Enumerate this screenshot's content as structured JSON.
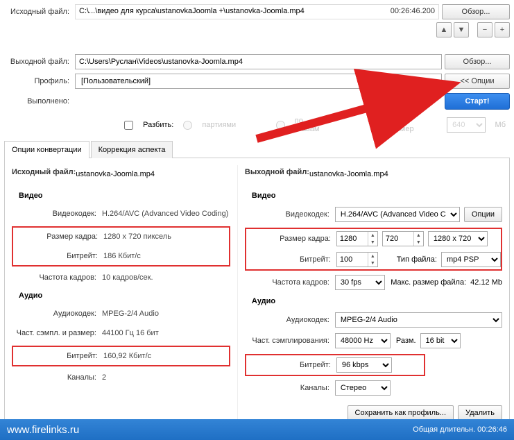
{
  "source": {
    "label": "Исходный файл:",
    "path": "C:\\...\\видео для курса\\ustanovkaJoomla +\\ustanovka-Joomla.mp4",
    "duration": "00:26:46.200",
    "browse": "Обзор..."
  },
  "output": {
    "label": "Выходной файл:",
    "path": "C:\\Users\\Руслан\\Videos\\ustanovka-Joomla.mp4",
    "browse": "Обзор..."
  },
  "profile": {
    "label": "Профиль:",
    "value": "[Пользовательский]",
    "options": "<< Опции"
  },
  "done": {
    "label": "Выполнено:"
  },
  "start": "Старт!",
  "split": {
    "checkbox": "Разбить:",
    "radio1": "партиями",
    "radio2": "по главам",
    "radio3": "лимит размер",
    "size": "640",
    "unit": "Мб"
  },
  "tabs": {
    "t1": "Опции конвертации",
    "t2": "Коррекция аспекта"
  },
  "left": {
    "title_prefix": "Исходный файл: ",
    "filename": "ustanovka-Joomla.mp4",
    "video": "Видео",
    "codec_l": "Видеокодек:",
    "codec_v": "H.264/AVC (Advanced Video Coding)",
    "frame_l": "Размер кадра:",
    "frame_v": "1280 x 720 пиксель",
    "bitrate_l": "Битрейт:",
    "bitrate_v": "186 Кбит/с",
    "fps_l": "Частота кадров:",
    "fps_v": "10 кадров/сек.",
    "audio": "Аудио",
    "acodec_l": "Аудиокодек:",
    "acodec_v": "MPEG-2/4 Audio",
    "asample_l": "Част. сэмпл. и размер:",
    "asample_v": "44100 Гц 16 бит",
    "abitrate_l": "Битрейт:",
    "abitrate_v": "160,92 Кбит/с",
    "chan_l": "Каналы:",
    "chan_v": "2"
  },
  "right": {
    "title_prefix": "Выходной файл: ",
    "filename": "ustanovka-Joomla.mp4",
    "video": "Видео",
    "codec_l": "Видеокодек:",
    "codec_v": "H.264/AVC (Advanced Video C",
    "opts": "Опции",
    "frame_l": "Размер кадра:",
    "frame_w": "1280",
    "frame_h": "720",
    "frame_preset": "1280 x 720",
    "bitrate_l": "Битрейт:",
    "bitrate_v": "100",
    "ftype_l": "Тип файла:",
    "ftype_v": "mp4 PSP",
    "fps_l": "Частота кадров:",
    "fps_v": "30 fps",
    "maxsize_l": "Макс. размер файла:",
    "maxsize_v": "42.12 Mb",
    "audio": "Аудио",
    "acodec_l": "Аудиокодек:",
    "acodec_v": "MPEG-2/4 Audio",
    "asample_l": "Част. сэмплирования:",
    "asample_v": "48000 Hz",
    "asize_l": "Разм.",
    "asize_v": "16 bit",
    "abitrate_l": "Битрейт:",
    "abitrate_v": "96 kbps",
    "chan_l": "Каналы:",
    "chan_v": "Стерео",
    "save_profile": "Сохранить как профиль...",
    "delete": "Удалить"
  },
  "footer": {
    "link": "www.firelinks.ru",
    "total_l": "Общая длительн.",
    "total_v": "00:26:46"
  }
}
